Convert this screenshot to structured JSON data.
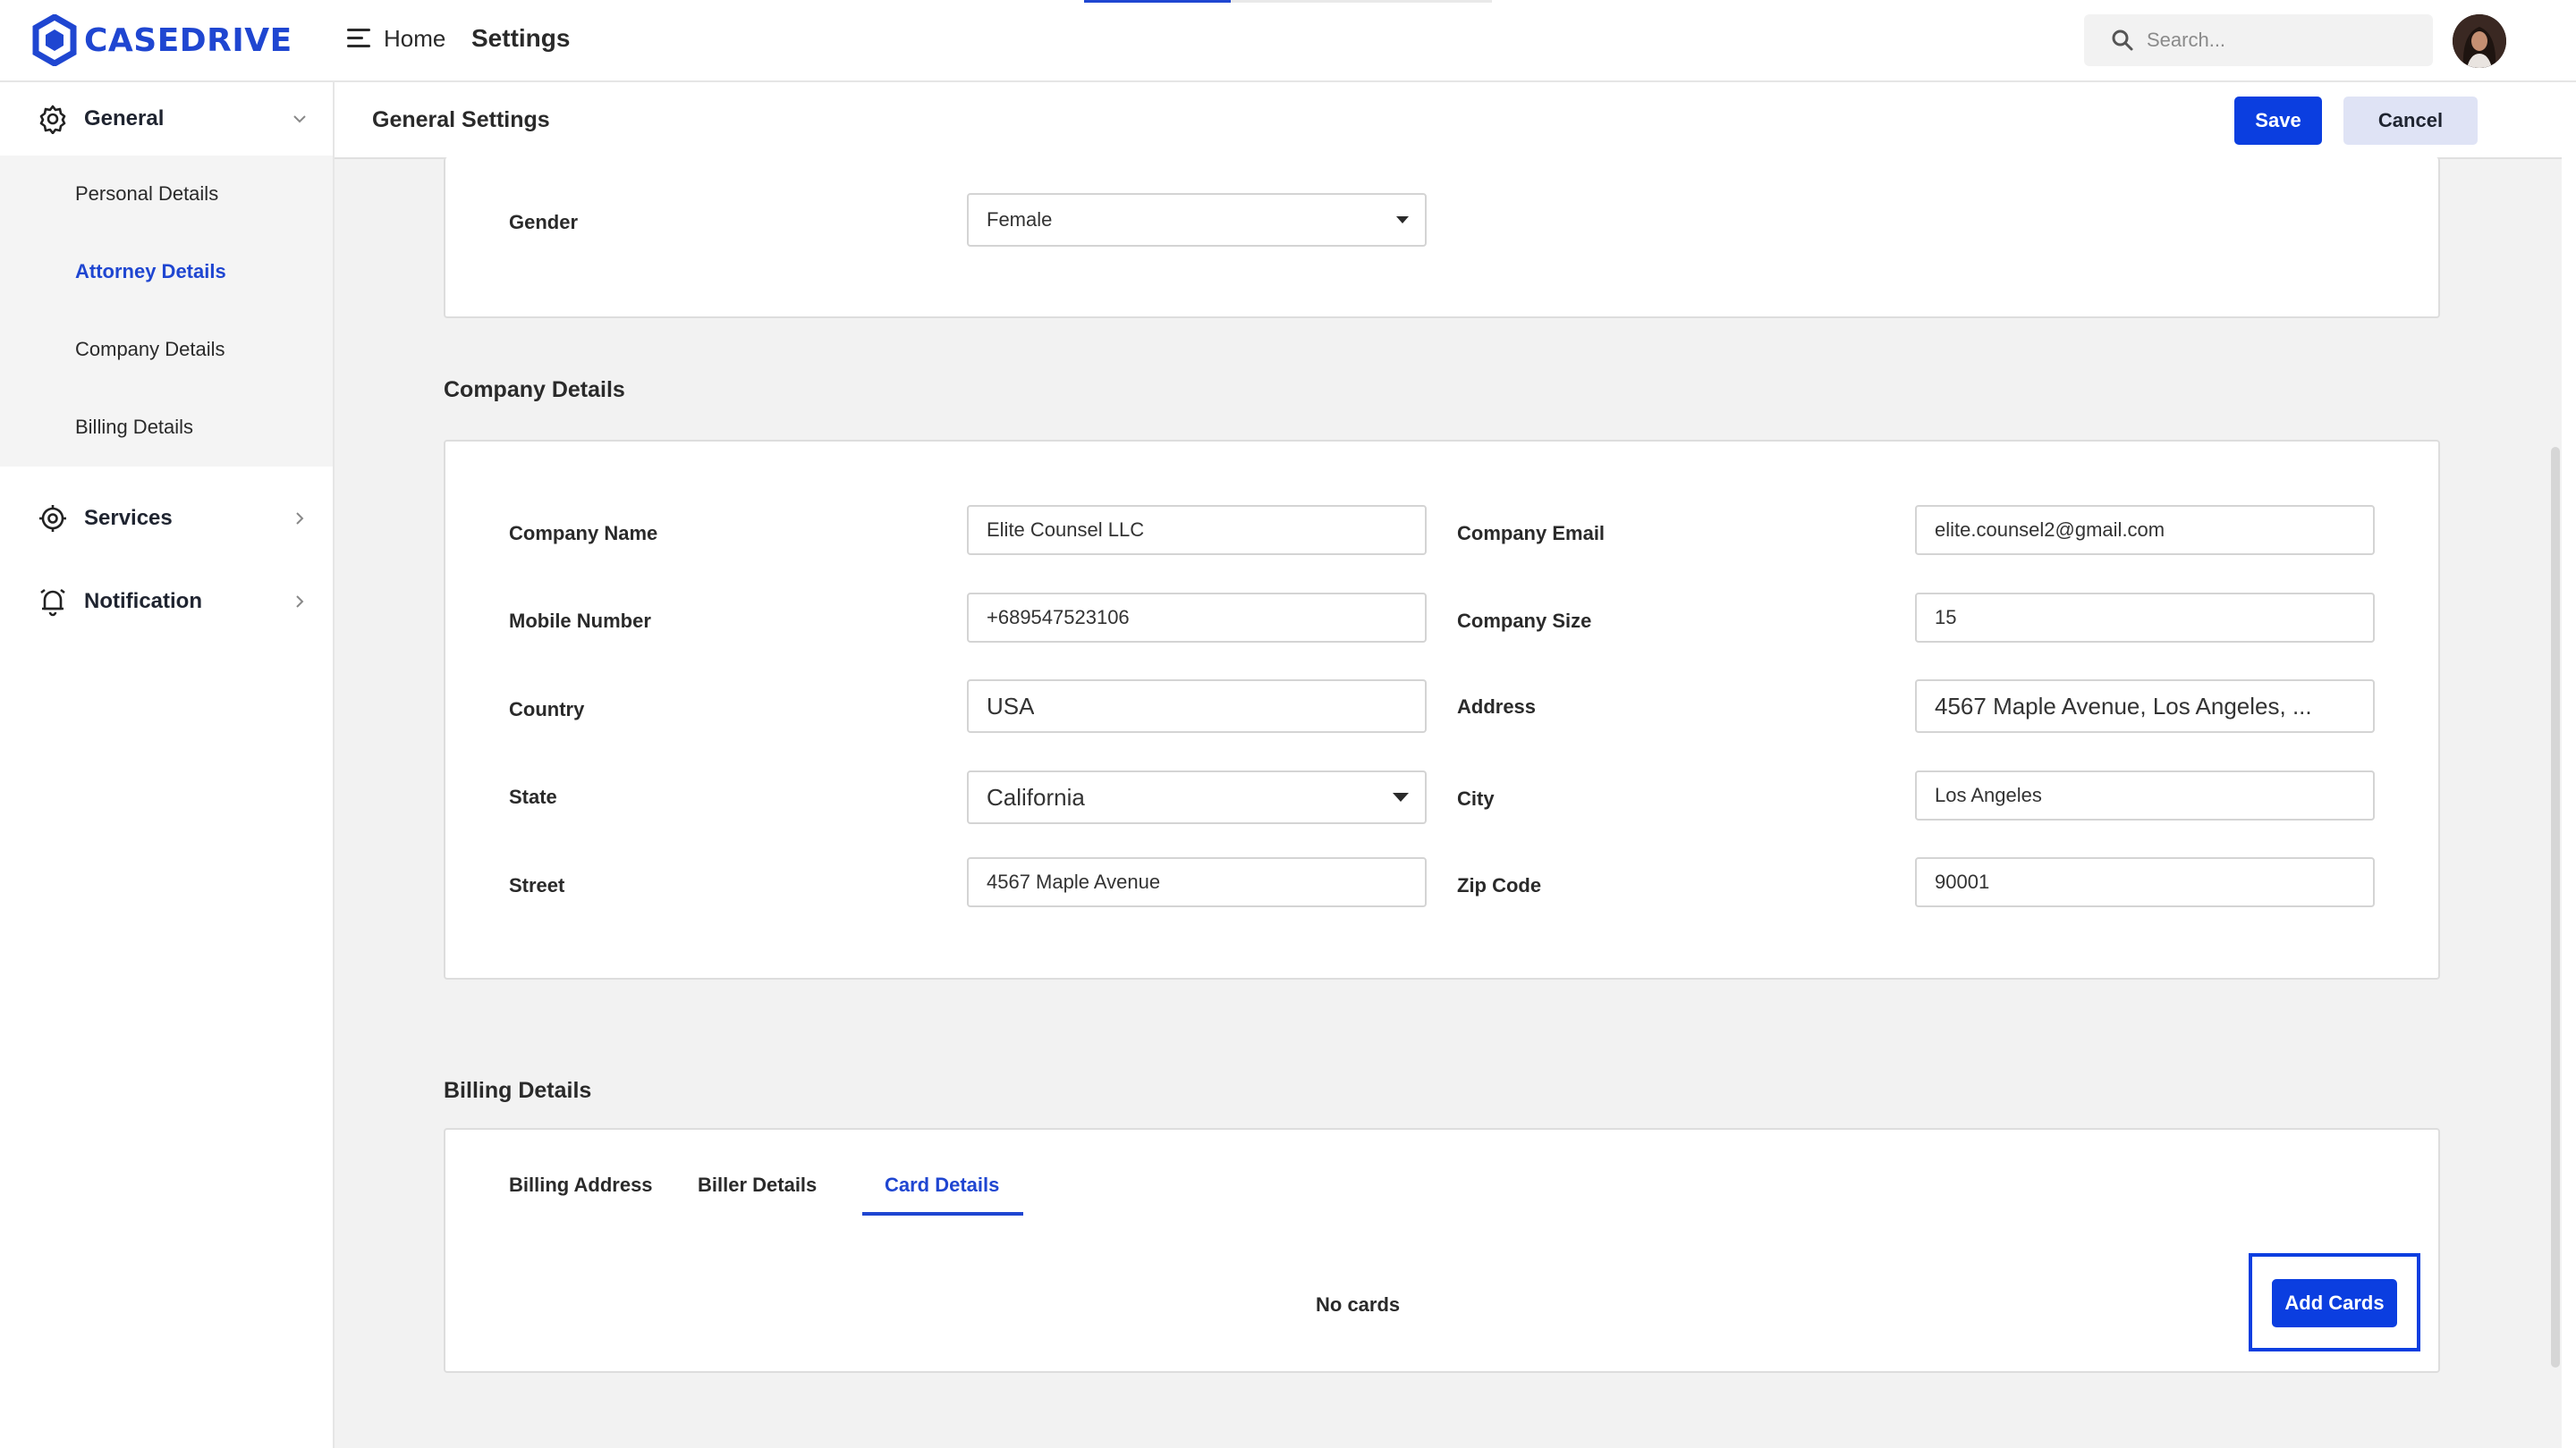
{
  "app": {
    "brand": "CASEDRIVE",
    "brand_color": "#1f46d1",
    "accent_color": "#0b3ee0"
  },
  "topbar": {
    "breadcrumb_home": "Home",
    "breadcrumb_current": "Settings",
    "search_placeholder": "Search...",
    "page_load_progress_percent": 36,
    "icons": {
      "menu": "menu-icon",
      "search": "search-icon",
      "avatar": "avatar"
    }
  },
  "sidebar": {
    "groups": [
      {
        "label": "General",
        "icon": "gear-icon",
        "expanded": true,
        "items": [
          {
            "label": "Personal Details",
            "active": false
          },
          {
            "label": "Attorney Details",
            "active": true
          },
          {
            "label": "Company Details",
            "active": false
          },
          {
            "label": "Billing Details",
            "active": false
          }
        ]
      },
      {
        "label": "Services",
        "icon": "services-gear-icon",
        "expanded": false
      },
      {
        "label": "Notification",
        "icon": "bell-icon",
        "expanded": false
      }
    ]
  },
  "header": {
    "title": "General Settings",
    "save_label": "Save",
    "cancel_label": "Cancel"
  },
  "attorney": {
    "gender_label": "Gender",
    "gender_value": "Female"
  },
  "company": {
    "title": "Company Details",
    "fields": {
      "company_name": {
        "label": "Company Name",
        "value": "Elite Counsel LLC"
      },
      "company_email": {
        "label": "Company Email",
        "value": "elite.counsel2@gmail.com"
      },
      "mobile": {
        "label": "Mobile Number",
        "value": "+689547523106"
      },
      "company_size": {
        "label": "Company Size",
        "value": "15"
      },
      "country": {
        "label": "Country",
        "value": "USA"
      },
      "address": {
        "label": "Address",
        "value": "4567 Maple Avenue, Los Angeles, ..."
      },
      "state": {
        "label": "State",
        "value": "California"
      },
      "city": {
        "label": "City",
        "value": "Los Angeles"
      },
      "street": {
        "label": "Street",
        "value": "4567 Maple Avenue"
      },
      "zip": {
        "label": "Zip Code",
        "value": "90001"
      }
    }
  },
  "billing": {
    "title": "Billing Details",
    "tabs": [
      {
        "label": "Billing Address",
        "active": false
      },
      {
        "label": "Biller Details",
        "active": false
      },
      {
        "label": "Card Details",
        "active": true
      }
    ],
    "empty_text": "No cards",
    "add_label": "Add Cards"
  }
}
